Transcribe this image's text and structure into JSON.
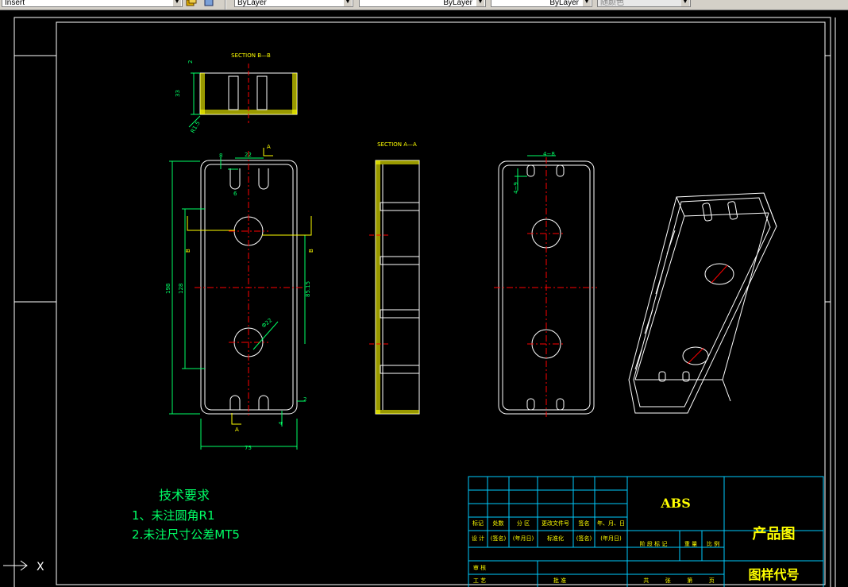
{
  "toolbar": {
    "layer_control": "Insert",
    "color_control": "ByLayer",
    "linetype_control": "ByLayer",
    "lineweight_control": "ByLayer",
    "plotstyle_control": "随颜色"
  },
  "drawing": {
    "section_bb_label": "SECTION B—B",
    "section_aa_label": "SECTION A—A",
    "dims": {
      "d_2_top": "2",
      "d_33": "33",
      "d_r15": "R1.5",
      "d_8": "8",
      "d_22": "22",
      "d_a_top": "A",
      "d_6": "6",
      "d_198": "198",
      "d_128": "128",
      "d_b_left": "B",
      "d_b_right": "B",
      "d_phi22": "Φ22",
      "d_8515": "85.15",
      "d_2_right": "2",
      "d_a_bottom": "A",
      "d_4_right": "4",
      "d_75": "75",
      "d_4_8": "4−8",
      "d_4_9": "4−9"
    }
  },
  "notes": {
    "heading": "技术要求",
    "line1": "1、未注圆角R1",
    "line2": "2.未注尺寸公差MT5"
  },
  "title_block": {
    "material": "ABS",
    "product_name": "产品图",
    "drawing_code_label": "图样代号",
    "row_labels": [
      "标记",
      "处数",
      "分 区",
      "更改文件号",
      "签名",
      "年、月、日"
    ],
    "design_row": [
      "设 计",
      "(签名)",
      "(年月日)",
      "标准化",
      "(签名)",
      "(年月日)"
    ],
    "stage_row": [
      "阶 段 标 记",
      "重 量",
      "比 例"
    ],
    "review": "审 核",
    "process": "工 艺",
    "approve": "批 准",
    "sheet_row": [
      "共",
      "张",
      "第",
      "页"
    ]
  }
}
